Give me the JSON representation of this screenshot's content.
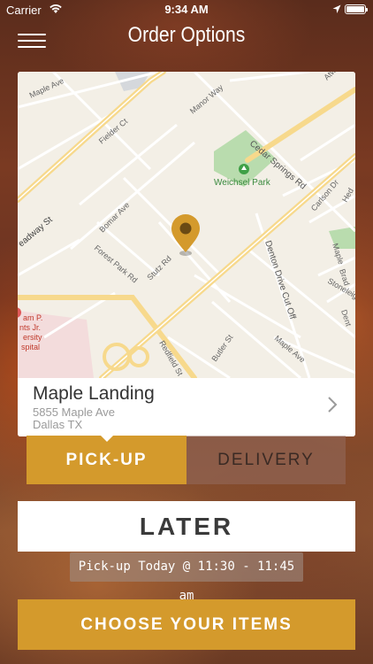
{
  "status_bar": {
    "carrier": "Carrier",
    "time": "9:34 AM",
    "battery_percent": 100
  },
  "nav": {
    "title": "Order Options",
    "menu_icon": "hamburger-menu-icon"
  },
  "map": {
    "labels": {
      "maple_ave_top": "Maple Ave",
      "fielder_ct": "Fielder Ct",
      "manor_way": "Manor Way",
      "cedar_springs_rd": "Cedar Springs Rd",
      "weichsel_park": "Weichsel Park",
      "carlson_dr": "Carlson Dr",
      "broadway_st": "eadway St",
      "bomar_ave": "Bomar Ave",
      "forest_park_rd": "Forest Park Rd",
      "stutz_rd": "Stutz Rd",
      "denton_drive_cut_off": "Denton Drive Cut Off",
      "maple_right": "Maple",
      "bradford": "Brad",
      "stoneleigh": "Stoneleigh",
      "dent": "Dent",
      "hospital_name": "am P.",
      "hospital_name2": "nts Jr.",
      "hospital_name3": "ersity",
      "hospital_name4": "spital",
      "redfield_st": "Redfield St",
      "butler_st": "Butler St",
      "maple_ave_bottom": "Maple Ave",
      "atwell": "Atw",
      "hed": "Hed"
    },
    "colors": {
      "land": "#f3efe6",
      "road": "#ffffff",
      "highway": "#f7d98c",
      "park": "#b9dcae",
      "pin": "#d49a2c"
    }
  },
  "location": {
    "name": "Maple Landing",
    "address_line1": "5855 Maple Ave",
    "address_line2": "Dallas TX"
  },
  "tabs": {
    "pickup": "PICK-UP",
    "delivery": "DELIVERY",
    "active": "pickup"
  },
  "later_button": "LATER",
  "pickup_time": "Pick-up Today @ 11:30 - 11:45 am",
  "choose_button": "CHOOSE YOUR ITEMS",
  "accent_color": "#d49a2c"
}
